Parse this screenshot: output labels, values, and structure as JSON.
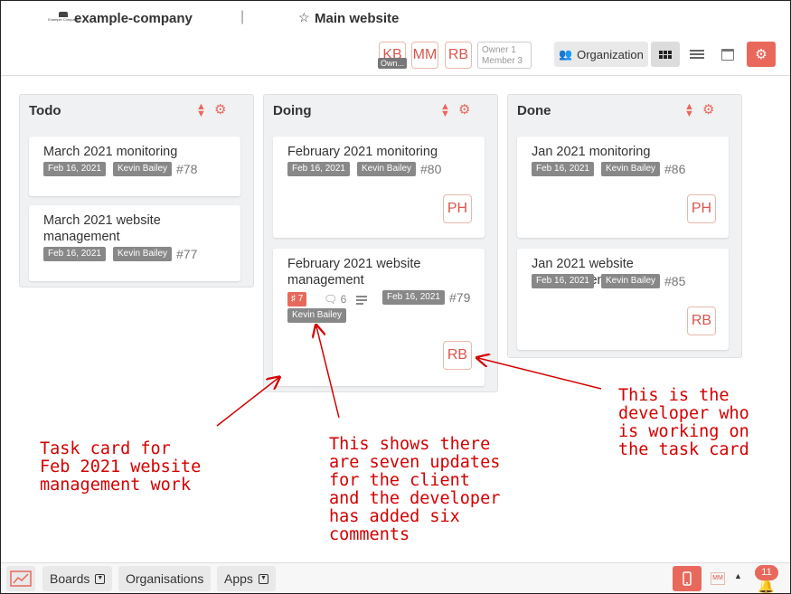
{
  "header": {
    "company_logo_text": "Example Company",
    "company_name": "example-company",
    "separator": "|",
    "site_name": "Main website",
    "avatars": [
      "KB",
      "MM",
      "RB"
    ],
    "avatar_role": "Own...",
    "owner_count": "Owner 1",
    "member_count": "Member 3",
    "organization_label": "Organization",
    "icons": [
      "star-icon",
      "users-icon",
      "grid-icon",
      "list-icon",
      "calendar-icon",
      "gear-icon"
    ]
  },
  "columns": [
    {
      "title": "Todo",
      "cards": [
        {
          "title": "March 2021 monitoring",
          "date": "Feb 16, 2021",
          "assignee": "Kevin Bailey",
          "number": "#78"
        },
        {
          "title": "March 2021 website management",
          "date": "Feb 16, 2021",
          "assignee": "Kevin Bailey",
          "number": "#77"
        }
      ]
    },
    {
      "title": "Doing",
      "cards": [
        {
          "title": "February 2021 monitoring",
          "date": "Feb 16, 2021",
          "assignee": "Kevin Bailey",
          "number": "#80",
          "developer": "PH"
        },
        {
          "title": "February 2021 website management",
          "updates": "7",
          "comments": "6",
          "date": "Feb 16, 2021",
          "assignee": "Kevin Bailey",
          "number": "#79",
          "developer": "RB"
        }
      ]
    },
    {
      "title": "Done",
      "cards": [
        {
          "title": "Jan 2021 monitoring",
          "date": "Feb 16, 2021",
          "assignee": "Kevin Bailey",
          "number": "#86",
          "developer": "PH"
        },
        {
          "title": "Jan 2021 website management",
          "date": "Feb 16, 2021",
          "assignee": "Kevin Bailey",
          "number": "#85",
          "developer": "RB"
        }
      ]
    }
  ],
  "annotations": {
    "task_card": "Task card for\nFeb 2021 website\nmanagement work",
    "updates": "This shows there\nare seven updates\nfor the client\nand the developer\nhas added six\ncomments",
    "developer": "This is the\ndeveloper who\nis working on\nthe task card",
    "color": "#d40000"
  },
  "bottombar": {
    "boards_label": "Boards",
    "organisations_label": "Organisations",
    "apps_label": "Apps",
    "user_initials": "MM",
    "notification_count": "11"
  },
  "colors": {
    "accent": "#e8695c",
    "tag": "#888888",
    "column_bg": "#f0f1f3"
  }
}
